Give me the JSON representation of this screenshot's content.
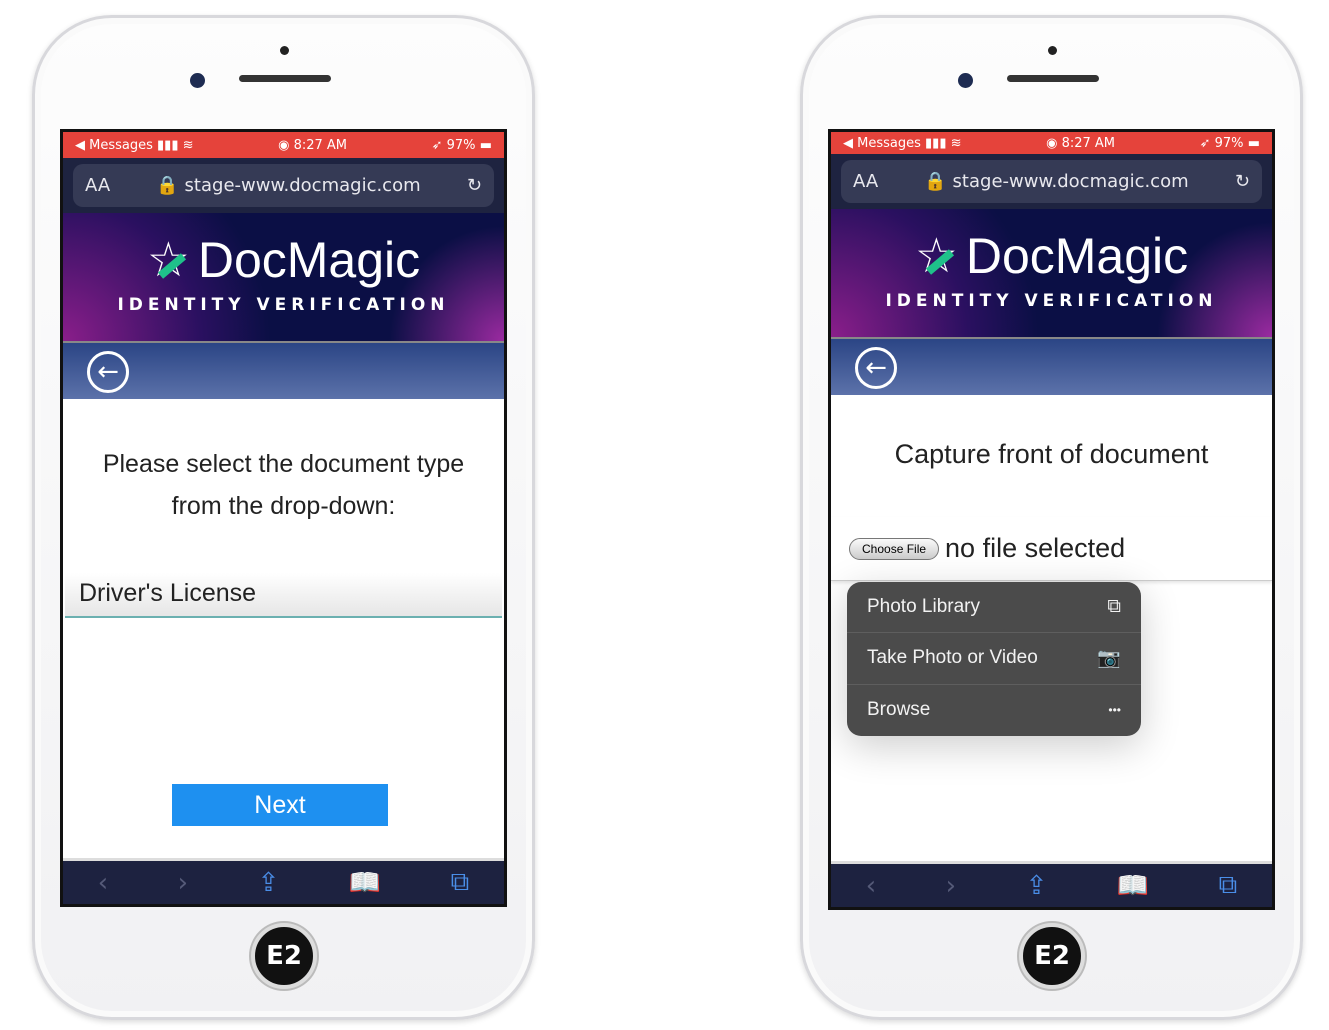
{
  "status": {
    "back_app": "◀ Messages",
    "signal": "▮▮▮",
    "time": "8:27 AM",
    "battery": "97%"
  },
  "url": {
    "text_size": "AA",
    "address": "stage-www.docmagic.com"
  },
  "brand": {
    "name": "DocMagic",
    "tagline": "IDENTITY VERIFICATION",
    "accent": "#1fc18a"
  },
  "home_label": "E2",
  "left": {
    "prompt_line1": "Please select the document type",
    "prompt_line2": "from the drop-down:",
    "select_value": "Driver's License",
    "next_label": "Next"
  },
  "right": {
    "title": "Capture front of document",
    "choose_file": "Choose File",
    "no_file": "no file selected",
    "menu": [
      {
        "label": "Photo Library",
        "icon": "photo-library-icon",
        "glyph": "⧉"
      },
      {
        "label": "Take Photo or Video",
        "icon": "camera-icon",
        "glyph": "📷"
      },
      {
        "label": "Browse",
        "icon": "more-icon",
        "glyph": "•••"
      }
    ]
  },
  "toolbar": {
    "back": "‹",
    "forward": "›",
    "share": "⇪",
    "bookmarks": "📖",
    "tabs": "⧉"
  }
}
